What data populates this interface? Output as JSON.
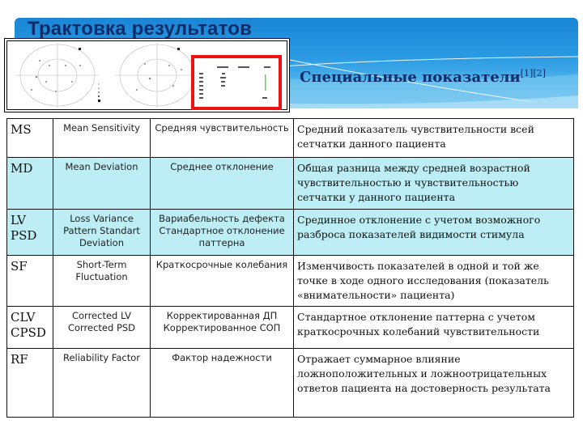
{
  "slide": {
    "title": "Трактовка результатов",
    "subtitle": "Специальные показатели",
    "subtitle_refs": "[1][2]",
    "colors": {
      "banner_top": "#1a86d6",
      "banner_bottom": "#8fd0f2",
      "title_text": "#0d2d6b",
      "highlight_frame": "#e11111",
      "row_highlight": "#bdeef5"
    }
  },
  "inset_image": {
    "description": "visual-field-printout",
    "legend": [
      "P>5",
      "P<5",
      "P<2",
      "P<1",
      "P<0.5"
    ],
    "highlighted_panel": {
      "columns": [
        "Phase I",
        "Phase II",
        "Mean"
      ],
      "rows": [
        "MS",
        "MD",
        "LV",
        "CLV",
        "SF",
        "RF"
      ]
    }
  },
  "table": {
    "rows": [
      {
        "abbr": "MS",
        "english": "Mean Sensitivity",
        "russian": "Средняя чувствительность",
        "description": "Средний показатель чувствительности всей сетчатки данного пациента",
        "highlight": false
      },
      {
        "abbr": "MD",
        "english": "Mean Deviation",
        "russian": "Среднее отклонение",
        "description": "Общая разница между средней возрастной чувствительностью и чувствительностью сетчатки у данного пациента",
        "highlight": true
      },
      {
        "abbr": "LV PSD",
        "english": "Loss Variance Pattern Standart Deviation",
        "russian": "Вариабельность дефекта Стандартное отклонение паттерна",
        "description": "Срединное отклонение с учетом возможного разброса показателей видимости стимула",
        "highlight": true
      },
      {
        "abbr": "SF",
        "english": "Short-Term Fluctuation",
        "russian": "Краткосрочные колебания",
        "description": "Изменчивость показателей в одной и той же точке в ходе одного исследования (показатель «внимательности» пациента)",
        "highlight": false
      },
      {
        "abbr": "CLV CPSD",
        "english": "Corrected LV Corrected PSD",
        "russian": "Корректированная ДП Корректированное СОП",
        "description": "Стандартное отклонение паттерна с учетом краткосрочных колебаний чувствительности",
        "highlight": false
      },
      {
        "abbr": "RF",
        "english": "Reliability Factor",
        "russian": "Фактор надежности",
        "description": "Отражает суммарное влияние ложноположительных и ложноотрицательных ответов пациента на достоверность результата",
        "highlight": false
      }
    ]
  }
}
